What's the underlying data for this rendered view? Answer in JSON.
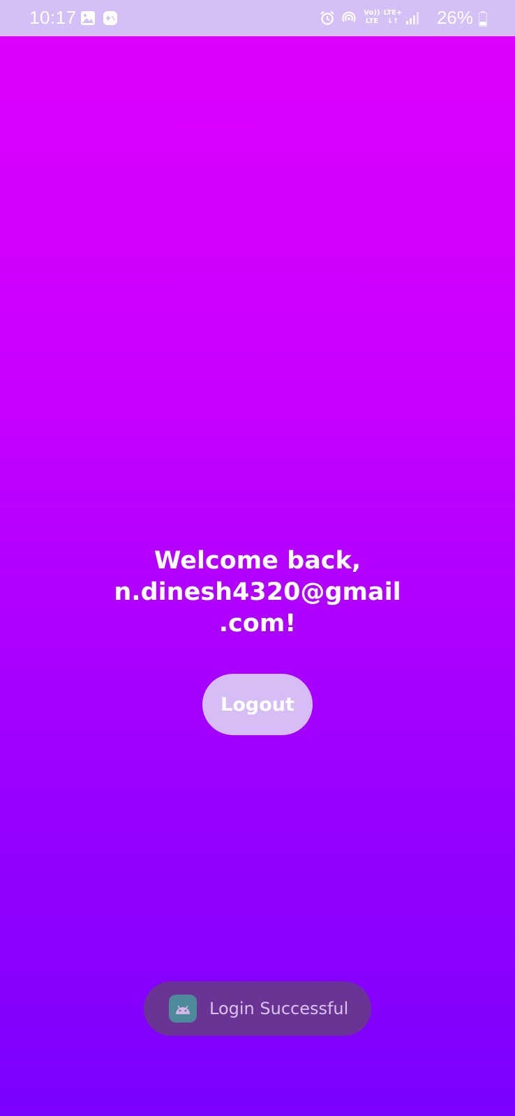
{
  "status_bar": {
    "time": "10:17",
    "network_volte": "Vo))\nLTE",
    "network_lte": "LTE+",
    "battery_percent": "26%",
    "icons": [
      "gallery-icon",
      "game-icon",
      "alarm-icon",
      "hotspot-icon",
      "volte-icon",
      "lte-icon",
      "signal-icon",
      "battery-icon"
    ]
  },
  "main": {
    "welcome_line1": "Welcome back, n.dinesh4320@gmail",
    "welcome_line2": ".com!",
    "logout_label": "Logout"
  },
  "toast": {
    "message": "Login Successful",
    "icon": "android-icon"
  },
  "colors": {
    "status_bar_bg": "#d4bff7",
    "gradient_top": "#e100ff",
    "gradient_bottom": "#7a00ff",
    "button_bg": "#d6bdf6",
    "toast_bg": "#6a3494"
  }
}
